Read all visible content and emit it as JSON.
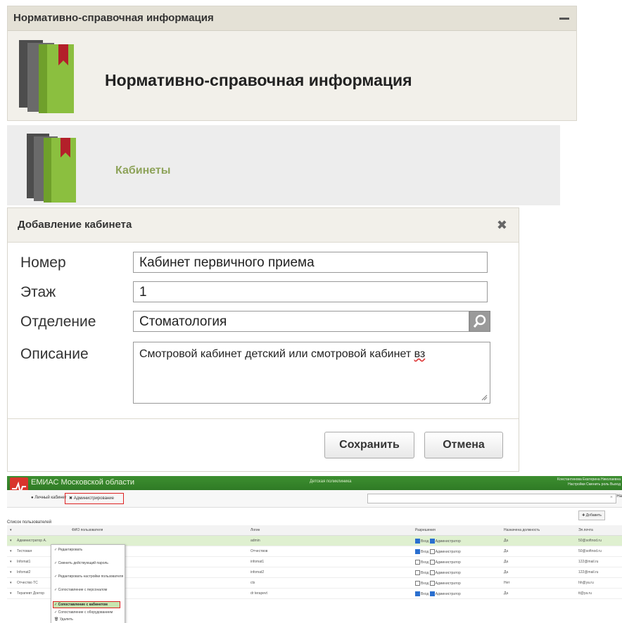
{
  "panel1": {
    "title": "Нормативно-справочная информация",
    "heading": "Нормативно-справочная информация"
  },
  "panel2": {
    "title": "Кабинеты"
  },
  "dialog": {
    "title": "Добавление кабинета",
    "fields": {
      "number": {
        "label": "Номер",
        "value": "Кабинет первичного приема"
      },
      "floor": {
        "label": "Этаж",
        "value": "1"
      },
      "department": {
        "label": "Отделение",
        "value": "Стоматология"
      },
      "description": {
        "label": "Описание",
        "value_main": "Смотровой кабинет детский или смотровой кабинет",
        "value_last": "вз"
      }
    },
    "save_label": "Сохранить",
    "cancel_label": "Отмена"
  },
  "app": {
    "name": "ЕМИАС Московской области",
    "center_text": "Детская поликлиника",
    "user_line1": "Константинова Екатерина Николаевна",
    "user_line2": "Настройки  Сменить роль  Выход",
    "nav_personal": "Личный кабинет",
    "nav_admin": "Администрирование",
    "find_label": "На",
    "add_label": "Добавить",
    "list_title": "Список пользователей",
    "columns": [
      "ФИО пользователя",
      "Логин",
      "Разрешения",
      "Назначена должность",
      "Эл.почта"
    ],
    "rows": [
      {
        "name": "Администратор А.",
        "login": "admin",
        "perm1": "Вход",
        "perm1_on": true,
        "perm2": "Администратор",
        "perm2_on": true,
        "pos": "Да",
        "email": "50@softnod.ru"
      },
      {
        "name": "Тестовая",
        "login": "Отчествов",
        "perm1": "Вход",
        "perm1_on": true,
        "perm2": "Администратор",
        "perm2_on": false,
        "pos": "Да",
        "email": "50@softnod.ru"
      },
      {
        "name": "Infomat1",
        "login": "infomat1",
        "perm1": "Вход",
        "perm1_on": false,
        "perm2": "Администратор",
        "perm2_on": false,
        "pos": "Да",
        "email": "122@mail.ru"
      },
      {
        "name": "Infomat2",
        "login": "infomat2",
        "perm1": "Вход",
        "perm1_on": false,
        "perm2": "Администратор",
        "perm2_on": false,
        "pos": "Да",
        "email": "122@mail.ru"
      },
      {
        "name": "Отчество ТС",
        "login": "cts",
        "perm1": "Вход",
        "perm1_on": false,
        "perm2": "Администратор",
        "perm2_on": false,
        "pos": "Нет",
        "email": "hh@ya.ru"
      },
      {
        "name": "Терапевт Доктор",
        "login": "dr terapevt",
        "perm1": "Вход",
        "perm1_on": true,
        "perm2": "Администратор",
        "perm2_on": true,
        "pos": "Да",
        "email": "tt@ya.ru"
      }
    ],
    "context_menu": [
      "Редактировать",
      "Сменить действующий пароль",
      "Редактировать настройки пользователя",
      "Сопоставление с персоналом",
      "Сопоставление с кабинетом",
      "Сопоставление с оборудованием",
      "Удалить"
    ]
  },
  "colors": {
    "accent_green": "#8ea35a",
    "header_bg": "#e4e1d6",
    "app_bar": "#2f7a25",
    "highlight_red": "#dd2222"
  }
}
